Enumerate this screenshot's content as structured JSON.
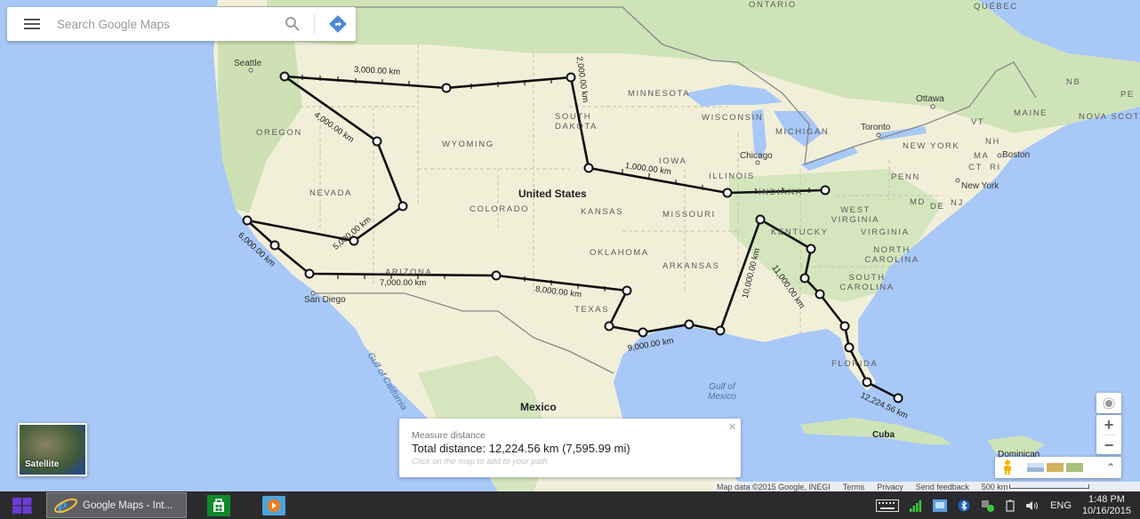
{
  "search": {
    "placeholder": "Search Google Maps",
    "menu_icon": "hamburger-menu-icon",
    "search_icon": "magnifier-icon",
    "directions_icon": "directions-diamond-icon",
    "directions_color": "#4a89dc"
  },
  "map": {
    "land_color": "#f2efd9",
    "green_color": "#cfe3b8",
    "water_color": "#a8c8f8",
    "route_color": "#000000",
    "countries": [
      {
        "name": "United States"
      },
      {
        "name": "Mexico"
      },
      {
        "name": "Cuba"
      },
      {
        "name": "Dominican"
      }
    ],
    "regions": [
      {
        "name": "ONTARIO"
      },
      {
        "name": "QUÉBEC"
      },
      {
        "name": "NB"
      },
      {
        "name": "PE"
      },
      {
        "name": "NOVA SCOTIA"
      },
      {
        "name": "OREGON"
      },
      {
        "name": "NEVADA"
      },
      {
        "name": "WYOMING"
      },
      {
        "name": "COLORADO"
      },
      {
        "name": "KANSAS"
      },
      {
        "name": "SOUTH DAKOTA"
      },
      {
        "name": "MINNESOTA"
      },
      {
        "name": "WISCONSIN"
      },
      {
        "name": "MICHIGAN"
      },
      {
        "name": "IOWA"
      },
      {
        "name": "ILLINOIS"
      },
      {
        "name": "INDIANA"
      },
      {
        "name": "MISSOURI"
      },
      {
        "name": "OKLAHOMA"
      },
      {
        "name": "ARKANSAS"
      },
      {
        "name": "ARIZONA"
      },
      {
        "name": "TEXAS"
      },
      {
        "name": "KENTUCKY"
      },
      {
        "name": "WEST VIRGINIA"
      },
      {
        "name": "VIRGINIA"
      },
      {
        "name": "NORTH CAROLINA"
      },
      {
        "name": "SOUTH CAROLINA"
      },
      {
        "name": "FLORIDA"
      },
      {
        "name": "PENN"
      },
      {
        "name": "NEW YORK"
      },
      {
        "name": "MAINE"
      },
      {
        "name": "VT"
      },
      {
        "name": "NH"
      },
      {
        "name": "MA"
      },
      {
        "name": "CT"
      },
      {
        "name": "RI"
      },
      {
        "name": "MD"
      },
      {
        "name": "DE"
      },
      {
        "name": "NJ"
      }
    ],
    "cities": [
      {
        "name": "Seattle"
      },
      {
        "name": "San Diego"
      },
      {
        "name": "Chicago"
      },
      {
        "name": "Toronto"
      },
      {
        "name": "Ottawa"
      },
      {
        "name": "Boston"
      },
      {
        "name": "New York"
      }
    ],
    "water_bodies": [
      {
        "name": "Gulf of California"
      },
      {
        "name": "Gulf of Mexico"
      }
    ],
    "distance_markers": [
      {
        "label": "1,000.00 km"
      },
      {
        "label": "2,000.00 km"
      },
      {
        "label": "3,000.00 km"
      },
      {
        "label": "4,000.00 km"
      },
      {
        "label": "5,000.00 km"
      },
      {
        "label": "6,000.00 km"
      },
      {
        "label": "7,000.00 km"
      },
      {
        "label": "8,000.00 km"
      },
      {
        "label": "9,000.00 km"
      },
      {
        "label": "10,000.00 km"
      },
      {
        "label": "11,000.00 km"
      },
      {
        "label": "12,224.56 km"
      }
    ]
  },
  "satellite": {
    "label": "Satellite"
  },
  "measure": {
    "title": "Measure distance",
    "total": "Total distance: 12,224.56 km (7,595.99 mi)",
    "hint": "Click on the map to add to your path",
    "close_icon": "close-x-icon"
  },
  "controls": {
    "locate_icon": "my-location-icon",
    "zoom_in": "+",
    "zoom_out": "−",
    "pegman_icon": "pegman-icon",
    "expand_icon": "double-chevron-up-icon",
    "expand_symbol": "⌃"
  },
  "attribution": {
    "map_data": "Map data ©2015 Google, INEGI",
    "terms": "Terms",
    "privacy": "Privacy",
    "feedback": "Send feedback",
    "scale": "500 km"
  },
  "taskbar": {
    "start_icon": "windows-logo-icon",
    "active_window": "Google Maps - Int...",
    "apps": [
      {
        "name": "store",
        "icon": "store-bag-icon"
      },
      {
        "name": "media-player",
        "icon": "video-play-icon"
      }
    ],
    "tray": {
      "language": "ENG",
      "time": "1:48 PM",
      "date": "10/16/2015"
    }
  }
}
